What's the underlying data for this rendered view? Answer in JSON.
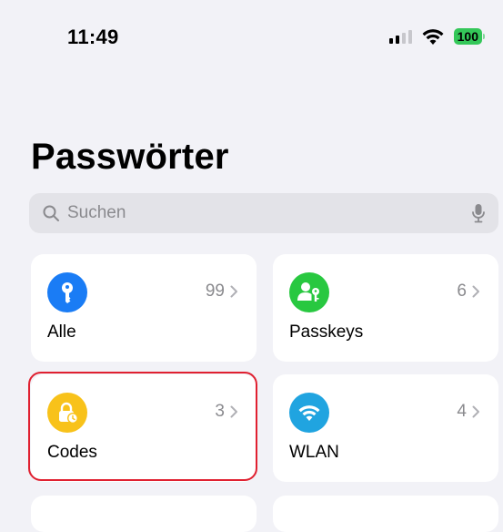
{
  "status_bar": {
    "time": "11:49",
    "battery": "100"
  },
  "title": "Passwörter",
  "search": {
    "placeholder": "Suchen"
  },
  "tiles": [
    {
      "label": "Alle",
      "count": "99",
      "icon": "key-icon",
      "color": "#1a7cf5"
    },
    {
      "label": "Passkeys",
      "count": "6",
      "icon": "person-key-icon",
      "color": "#28c840"
    },
    {
      "label": "Codes",
      "count": "3",
      "icon": "lock-clock-icon",
      "color": "#f8c21a"
    },
    {
      "label": "WLAN",
      "count": "4",
      "icon": "wifi-icon",
      "color": "#20a4e0"
    }
  ],
  "colors": {
    "highlight": "#e02030",
    "background": "#f2f2f7"
  }
}
